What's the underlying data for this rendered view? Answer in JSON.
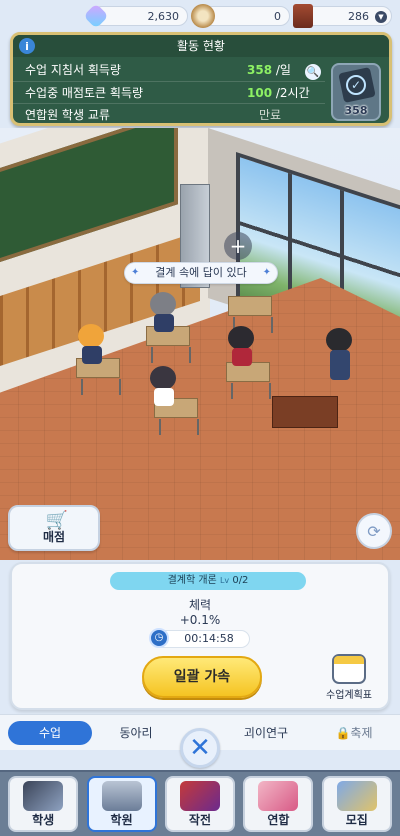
{
  "currency": {
    "gems": "2,630",
    "coins": "0",
    "tickets": "286",
    "gem_icon": "gem-icon",
    "coin_icon": "coin-icon",
    "ticket_icon": "ticket-icon"
  },
  "activity": {
    "title": "활동 현황",
    "rows": [
      {
        "label": "수업 지침서 획득량",
        "value": "358",
        "unit": " /일"
      },
      {
        "label": "수업중 매점토큰 획득량",
        "value": "100",
        "unit": " /2시간"
      },
      {
        "label": "연합원 학생 교류",
        "value": "만료"
      }
    ],
    "guide_count": "358"
  },
  "scene": {
    "reply_tag": "결계 속에 답이 있다",
    "add_marker": "+"
  },
  "shop": {
    "label": "매점"
  },
  "class_card": {
    "course": "결계학 개론",
    "level_prefix": "Lv",
    "progress": "0/2",
    "stat_name": "체력",
    "stat_value": "+0.1%",
    "timer": "00:14:58",
    "boost_label": "일괄 가속",
    "plan_label": "수업계획표"
  },
  "subtabs": {
    "items": [
      {
        "label": "수업",
        "active": true
      },
      {
        "label": "동아리",
        "active": false
      },
      {
        "label": "괴이연구",
        "active": false
      },
      {
        "label": "축제",
        "locked": true
      }
    ],
    "close": "✕"
  },
  "bottom_nav": {
    "items": [
      {
        "label": "학생"
      },
      {
        "label": "학원",
        "active": true
      },
      {
        "label": "작전"
      },
      {
        "label": "연합"
      },
      {
        "label": "모집"
      }
    ]
  },
  "colors": {
    "panel_bg": "#2f5b46",
    "panel_border": "#d8c074",
    "highlight_green": "#8df064",
    "accent_blue": "#2f74d8",
    "button_yellow": "#f5c422"
  }
}
